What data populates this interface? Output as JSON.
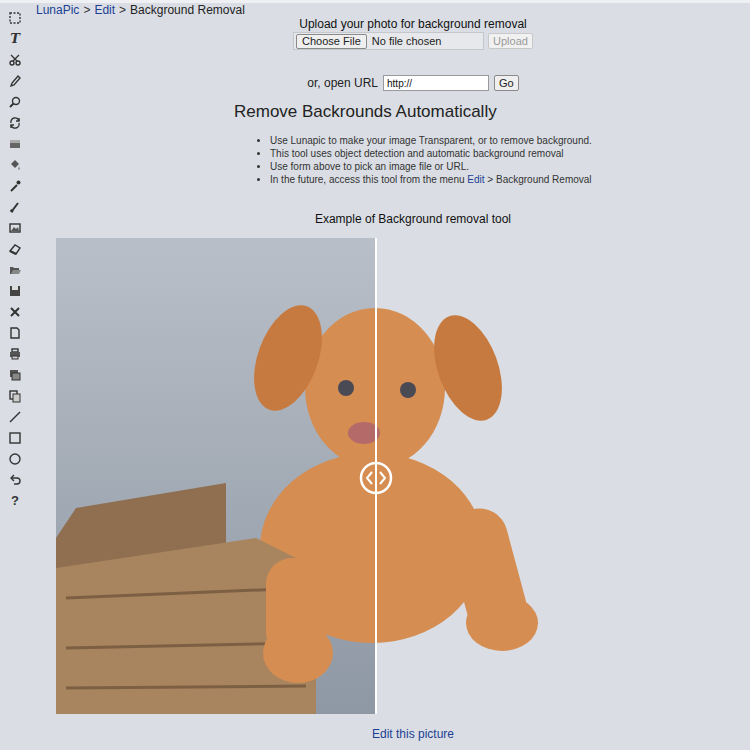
{
  "breadcrumb": {
    "separator": ">",
    "items": [
      {
        "label": "LunaPic",
        "link": true
      },
      {
        "label": "Edit",
        "link": true
      },
      {
        "label": "Background Removal",
        "link": false
      }
    ]
  },
  "toolbar": {
    "text_tool": "T",
    "help": "?"
  },
  "upload": {
    "title": "Upload your photo for background removal",
    "choose_button": "Choose File",
    "file_status": "No file chosen",
    "upload_button": "Upload",
    "upload_disabled": true
  },
  "url": {
    "label": "or, open URL",
    "value": "http://",
    "go_button": "Go"
  },
  "heading": "Remove Backrounds Automatically",
  "bullets": [
    [
      {
        "text": "Use Lunapic to make your image Transparent, or to remove background.",
        "link": false
      }
    ],
    [
      {
        "text": "This tool uses object detection and automatic background removal",
        "link": false
      }
    ],
    [
      {
        "text": "Use form above to pick an image file or URL.",
        "link": false
      }
    ],
    [
      {
        "text": "In the future, access this tool from the menu ",
        "link": false
      },
      {
        "text": "Edit",
        "link": true
      },
      {
        "text": " > Background Removal",
        "link": false
      }
    ]
  ],
  "example": {
    "title": "Example of Background removal tool"
  },
  "edit_link": "Edit this picture"
}
